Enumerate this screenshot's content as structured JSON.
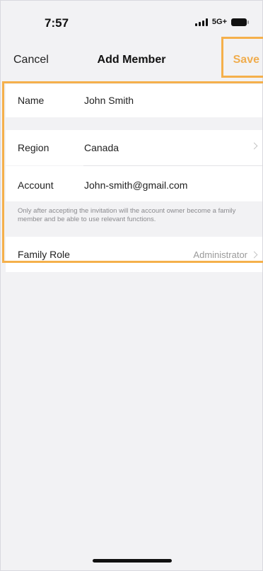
{
  "status_bar": {
    "time": "7:57",
    "network": "5G+"
  },
  "nav": {
    "cancel_label": "Cancel",
    "title": "Add Member",
    "save_label": "Save"
  },
  "form": {
    "name": {
      "label": "Name",
      "value": "John Smith"
    },
    "region": {
      "label": "Region",
      "value": "Canada"
    },
    "account": {
      "label": "Account",
      "value": "John-smith@gmail.com"
    },
    "note": "Only after accepting the invitation will the account owner become a family member and be able to use relevant functions.",
    "family_role": {
      "label": "Family Role",
      "value": "Administrator"
    }
  },
  "colors": {
    "accent": "#f0ad4e",
    "highlight": "#f5b04b",
    "background": "#f2f2f4"
  }
}
